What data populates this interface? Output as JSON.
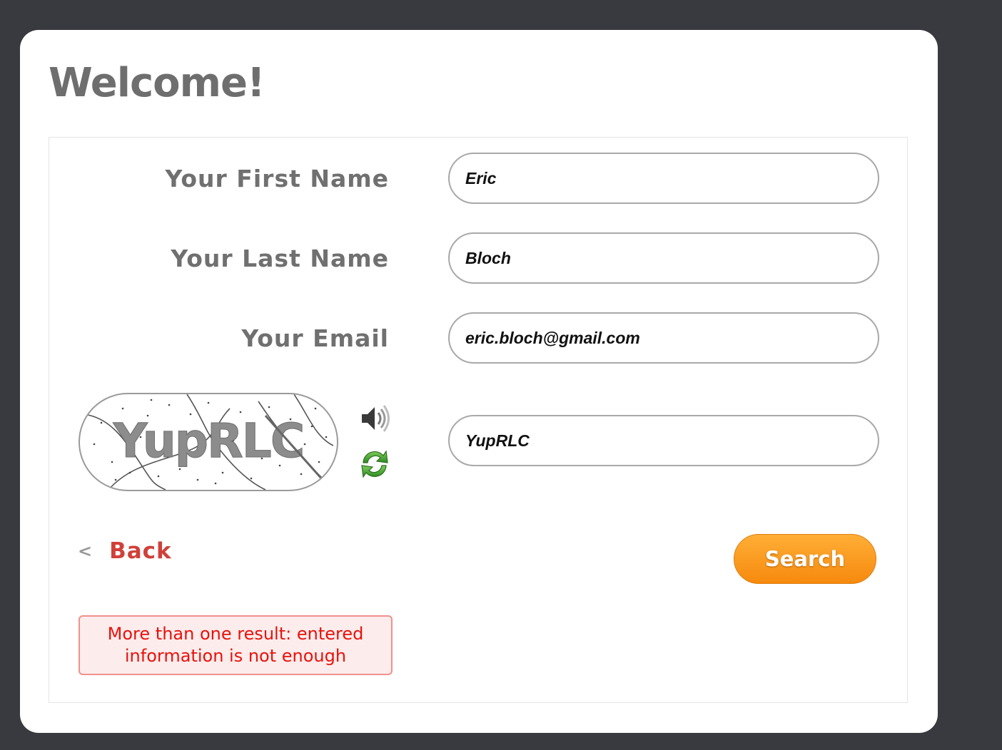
{
  "page": {
    "title": "Welcome!"
  },
  "form": {
    "first_name": {
      "label": "Your First Name",
      "value": "Eric"
    },
    "last_name": {
      "label": "Your Last Name",
      "value": "Bloch"
    },
    "email": {
      "label": "Your Email",
      "value": "eric.bloch@gmail.com"
    },
    "captcha": {
      "image_text": "YupRLC",
      "value": "YupRLC",
      "audio_icon": "speaker-icon",
      "refresh_icon": "refresh-icon"
    }
  },
  "actions": {
    "back_chevron": "<",
    "back_label": "Back",
    "search_label": "Search"
  },
  "error": {
    "line1": "More than one result: entered",
    "line2": "information is not enough"
  },
  "colors": {
    "background": "#383a3f",
    "card": "#ffffff",
    "label": "#707070",
    "back_link": "#d0403a",
    "search_button": "#f68a0e",
    "error_text": "#e8120c",
    "error_bg": "#fdecec"
  }
}
